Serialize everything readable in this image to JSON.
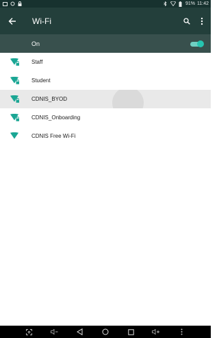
{
  "status_bar": {
    "battery_percent": "91%",
    "time": "11:42"
  },
  "app_bar": {
    "title": "Wi-Fi"
  },
  "wifi_switch": {
    "label": "On",
    "enabled": true,
    "accent_color": "#26c4b0"
  },
  "networks": [
    {
      "ssid": "Staff",
      "secured": true
    },
    {
      "ssid": "Student",
      "secured": true
    },
    {
      "ssid": "CDNIS_BYOD",
      "secured": true
    },
    {
      "ssid": "CDNIS_Onboarding",
      "secured": true
    },
    {
      "ssid": "CDNIS Free Wi-Fi",
      "secured": false
    }
  ],
  "nav_bar": {
    "buttons": [
      "screenshot-icon",
      "volume-down-icon",
      "back-icon",
      "home-icon",
      "recents-icon",
      "volume-up-icon",
      "more-vert-icon"
    ]
  }
}
